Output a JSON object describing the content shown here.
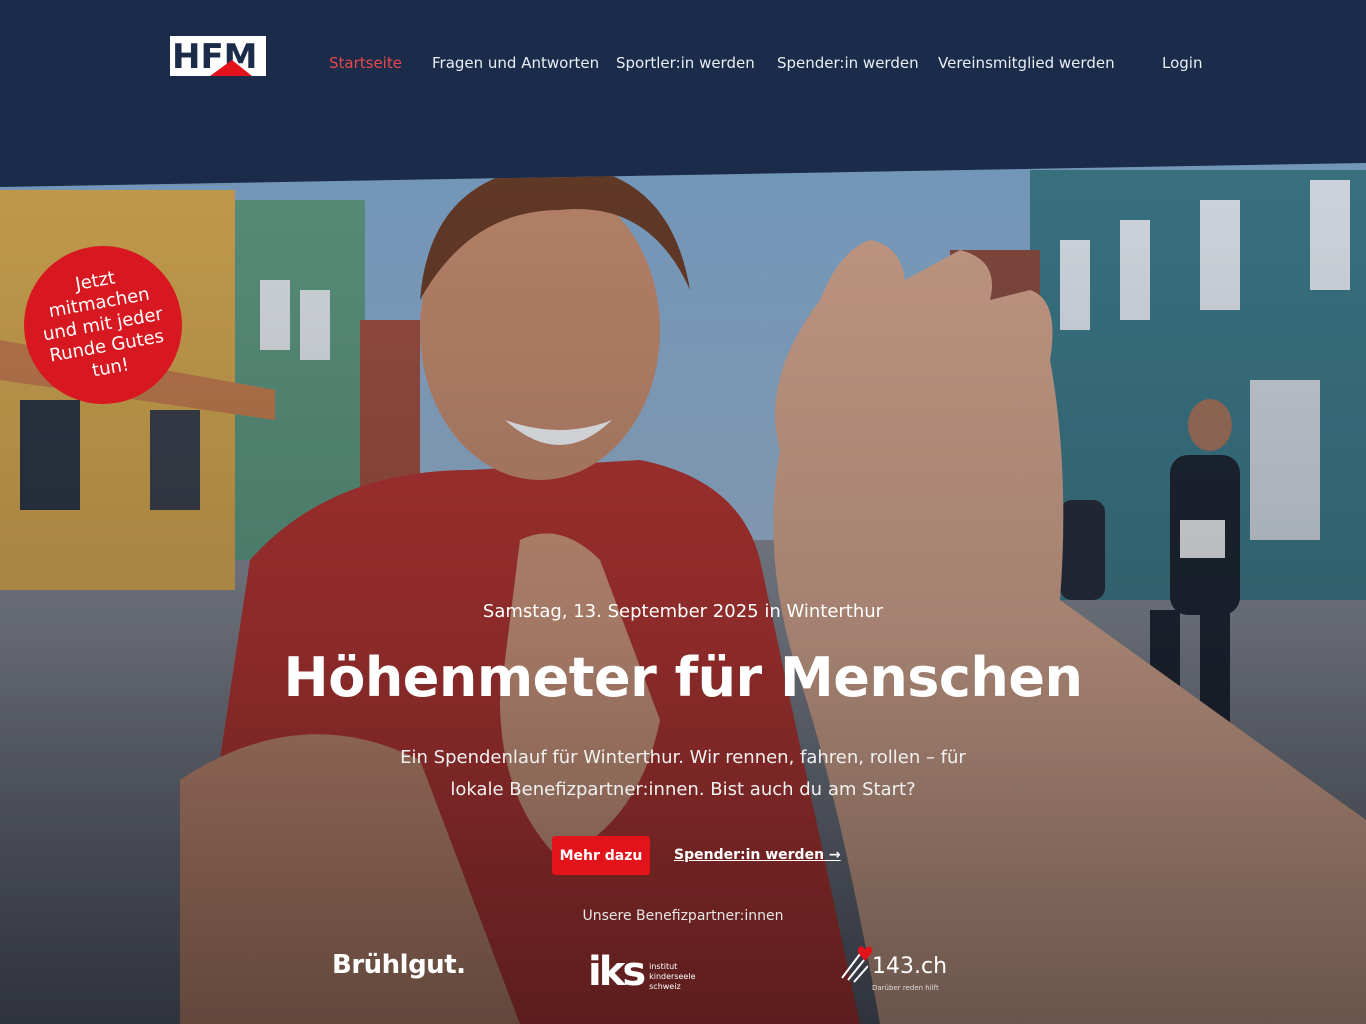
{
  "logo": {
    "text": "HFM"
  },
  "nav": {
    "items": [
      "Startseite",
      "Fragen und Antworten",
      "Sportler:in werden",
      "Spender:in werden",
      "Vereinsmitglied werden"
    ],
    "login": "Login"
  },
  "badge": {
    "text": "Jetzt mitmachen und mit jeder Runde Gutes tun!"
  },
  "hero": {
    "date": "Samstag, 13. September 2025 in Winterthur",
    "title": "Höhenmeter für Menschen",
    "description": "Ein Spendenlauf für Winterthur. Wir rennen, fahren, rollen – für lokale Benefizpartner:innen. Bist auch du am Start?",
    "cta_primary": "Mehr dazu",
    "cta_secondary": "Spender:in werden →"
  },
  "partners": {
    "title": "Unsere Benefizpartner:innen",
    "bruehlgut": "Brühlgut.",
    "iks_mark": "iks",
    "iks_line1": "institut",
    "iks_line2": "kinderseele",
    "iks_line3": "schweiz",
    "p143": "143.ch",
    "p143_sub": "Darüber reden hilft"
  },
  "colors": {
    "navy": "#1b2c4a",
    "accent": "#e3131b",
    "active_nav": "#e8474b"
  }
}
